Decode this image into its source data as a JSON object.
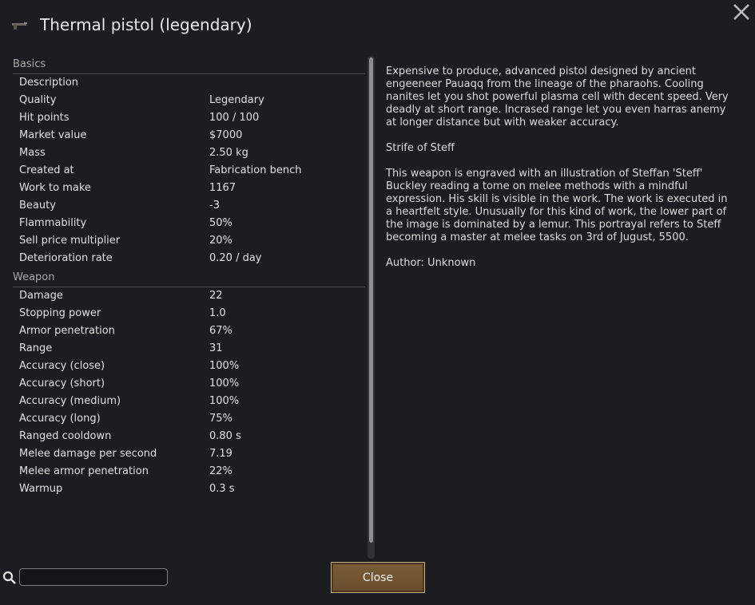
{
  "window": {
    "title": "Thermal pistol (legendary)",
    "title_icon": "pistol-icon",
    "close_icon": "close-icon"
  },
  "basics": {
    "heading": "Basics",
    "rows": [
      {
        "label": "Description",
        "value": ""
      },
      {
        "label": "Quality",
        "value": "Legendary"
      },
      {
        "label": "Hit points",
        "value": "100 / 100"
      },
      {
        "label": "Market value",
        "value": "$7000"
      },
      {
        "label": "Mass",
        "value": "2.50 kg"
      },
      {
        "label": "Created at",
        "value": "Fabrication bench"
      },
      {
        "label": "Work to make",
        "value": "1167"
      },
      {
        "label": "Beauty",
        "value": "-3"
      },
      {
        "label": "Flammability",
        "value": "50%"
      },
      {
        "label": "Sell price multiplier",
        "value": "20%"
      },
      {
        "label": "Deterioration rate",
        "value": "0.20 / day"
      }
    ]
  },
  "weapon": {
    "heading": "Weapon",
    "rows": [
      {
        "label": "Damage",
        "value": "22"
      },
      {
        "label": "Stopping power",
        "value": "1.0"
      },
      {
        "label": "Armor penetration",
        "value": "67%"
      },
      {
        "label": "Range",
        "value": "31"
      },
      {
        "label": "Accuracy (close)",
        "value": "100%"
      },
      {
        "label": "Accuracy (short)",
        "value": "100%"
      },
      {
        "label": "Accuracy (medium)",
        "value": "100%"
      },
      {
        "label": "Accuracy (long)",
        "value": "75%"
      },
      {
        "label": "Ranged cooldown",
        "value": "0.80 s"
      },
      {
        "label": "Melee damage per second",
        "value": "7.19"
      },
      {
        "label": "Melee armor penetration",
        "value": "22%"
      },
      {
        "label": "Warmup",
        "value": "0.3 s"
      }
    ]
  },
  "description": {
    "summary": "Expensive to produce, advanced pistol designed by ancient engeeneer Pauaqq from the lineage of the pharaohs. Cooling nanites let you shot powerful plasma cell with decent speed. Very deadly at short range. Incrased range let you even harras anemy at longer distance but with weaker accuracy.",
    "art_title": "Strife of Steff",
    "art_description": "This weapon is engraved with an illustration of Steffan 'Steff' Buckley reading a tome on melee methods with a mindful expression. His skill is visible in the work. The work is executed in a heartfelt style. Unusually for this kind of work, the lower part of the image is dominated by a lemur. This portrayal refers to Steff becoming a master at melee tasks on 3rd of Jugust, 5500.",
    "author": "Author: Unknown"
  },
  "footer": {
    "search_icon": "search-icon",
    "search_value": "",
    "close_label": "Close"
  }
}
